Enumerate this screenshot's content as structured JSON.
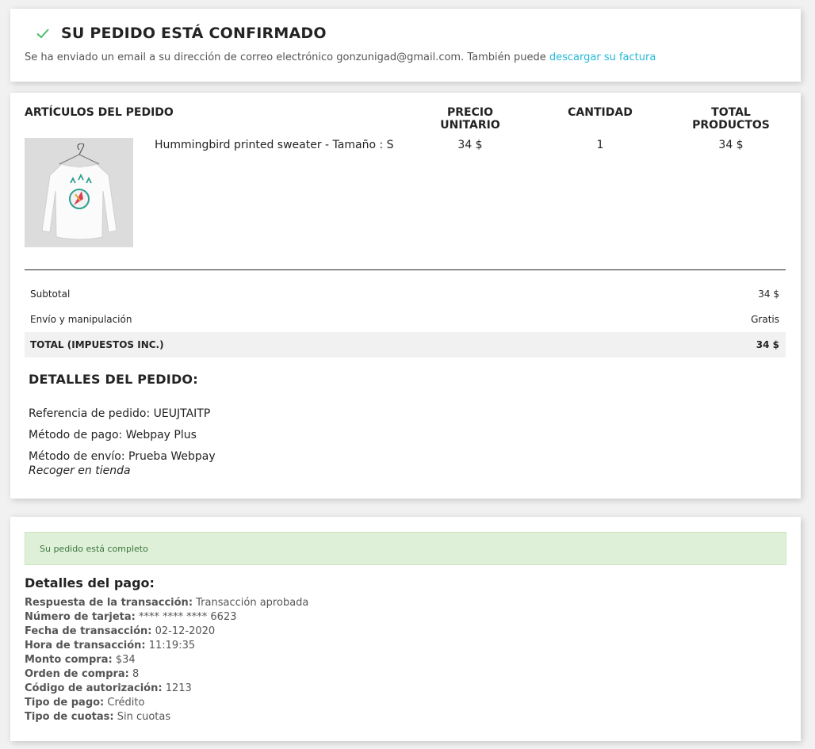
{
  "confirmation": {
    "title": "SU PEDIDO ESTÁ CONFIRMADO",
    "message": "Se ha enviado un email a su dirección de correo electrónico gonzunigad@gmail.com. También puede ",
    "invoice_link": "descargar su factura",
    "check_icon": "check-icon",
    "accent_color": "#24b9d7",
    "check_color": "#4cbb6c"
  },
  "order_table": {
    "headers": {
      "items": "ARTÍCULOS DEL PEDIDO",
      "unit_price": "PRECIO UNITARIO",
      "quantity": "CANTIDAD",
      "total_products": "TOTAL PRODUCTOS"
    },
    "items": [
      {
        "name": "Hummingbird printed sweater - Tamaño : S",
        "unit_price": "34 $",
        "quantity": "1",
        "total": "34 $",
        "image": "product-thumbnail"
      }
    ],
    "subtotal_label": "Subtotal",
    "subtotal_value": "34 $",
    "shipping_label": "Envío y manipulación",
    "shipping_value": "Gratis",
    "total_label": "TOTAL (IMPUESTOS INC.)",
    "total_value": "34 $"
  },
  "order_details": {
    "title": "DETALLES DEL PEDIDO:",
    "reference": "Referencia de pedido: UEUJTAITP",
    "payment_method": "Método de pago: Webpay Plus",
    "shipping_method": "Método de envío: Prueba Webpay",
    "pickup": "Recoger en tienda"
  },
  "payment": {
    "alert": "Su pedido está completo",
    "alert_color": "#dff0d8",
    "title": "Detalles del pago:",
    "fields": [
      {
        "label": "Respuesta de la transacción:",
        "value": "Transacción aprobada"
      },
      {
        "label": "Número de tarjeta:",
        "value": "**** **** **** 6623"
      },
      {
        "label": "Fecha de transacción:",
        "value": "02-12-2020"
      },
      {
        "label": "Hora de transacción:",
        "value": "11:19:35"
      },
      {
        "label": "Monto compra:",
        "value": "$34"
      },
      {
        "label": "Orden de compra:",
        "value": "8"
      },
      {
        "label": "Código de autorización:",
        "value": "1213"
      },
      {
        "label": "Tipo de pago:",
        "value": "Crédito"
      },
      {
        "label": "Tipo de cuotas:",
        "value": "Sin cuotas"
      }
    ]
  }
}
